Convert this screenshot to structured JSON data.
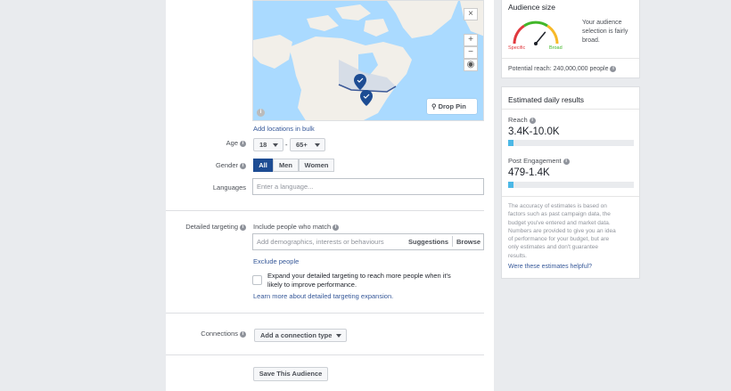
{
  "map": {
    "drop_pin_label": "Drop Pin",
    "zoom_in": "+",
    "zoom_out": "−",
    "close": "×",
    "info": "i"
  },
  "locations": {
    "add_bulk_link": "Add locations in bulk"
  },
  "age": {
    "label": "Age",
    "min_value": "18",
    "separator": "-",
    "max_value": "65+"
  },
  "gender": {
    "label": "Gender",
    "options": [
      "All",
      "Men",
      "Women"
    ],
    "selected": "All"
  },
  "languages": {
    "label": "Languages",
    "placeholder": "Enter a language..."
  },
  "detailed_targeting": {
    "label": "Detailed targeting",
    "include_label": "Include people who match",
    "input_placeholder": "Add demographics, interests or behaviours",
    "suggestions_label": "Suggestions",
    "browse_label": "Browse",
    "exclude_link": "Exclude people",
    "expand_text_line1": "Expand your detailed targeting to reach more people when it's",
    "expand_text_line2": "likely to improve performance.",
    "learn_more_link": "Learn more about detailed targeting expansion."
  },
  "connections": {
    "label": "Connections",
    "dropdown_label": "Add a connection type"
  },
  "save_audience_label": "Save This Audience",
  "audience_size": {
    "title": "Audience size",
    "gauge_specific": "Specific",
    "gauge_broad": "Broad",
    "description_line1": "Your audience",
    "description_line2": "selection is fairly",
    "description_line3": "broad.",
    "potential_reach": "Potential reach: 240,000,000 people",
    "gauge_level": 0.72
  },
  "estimated_results": {
    "title": "Estimated daily results",
    "reach_label": "Reach",
    "reach_value": "3.4K-10.0K",
    "reach_fill": 0.04,
    "engagement_label": "Post Engagement",
    "engagement_value": "479-1.4K",
    "engagement_fill": 0.04,
    "disclaimer_lines": [
      "The accuracy of estimates is based on",
      "factors such as past campaign data, the",
      "budget you've entered and market data.",
      "Numbers are provided to give you an idea",
      "of performance for your budget, but are",
      "only estimates and don't guarantee",
      "results."
    ],
    "helpful_link": "Were these estimates helpful?"
  },
  "colors": {
    "accent": "#1d4c93",
    "link": "#365899",
    "bar_fill": "#4cb8e6",
    "gauge_red": "#e0393e",
    "gauge_yellow": "#f7b928",
    "gauge_green": "#42b72a"
  }
}
